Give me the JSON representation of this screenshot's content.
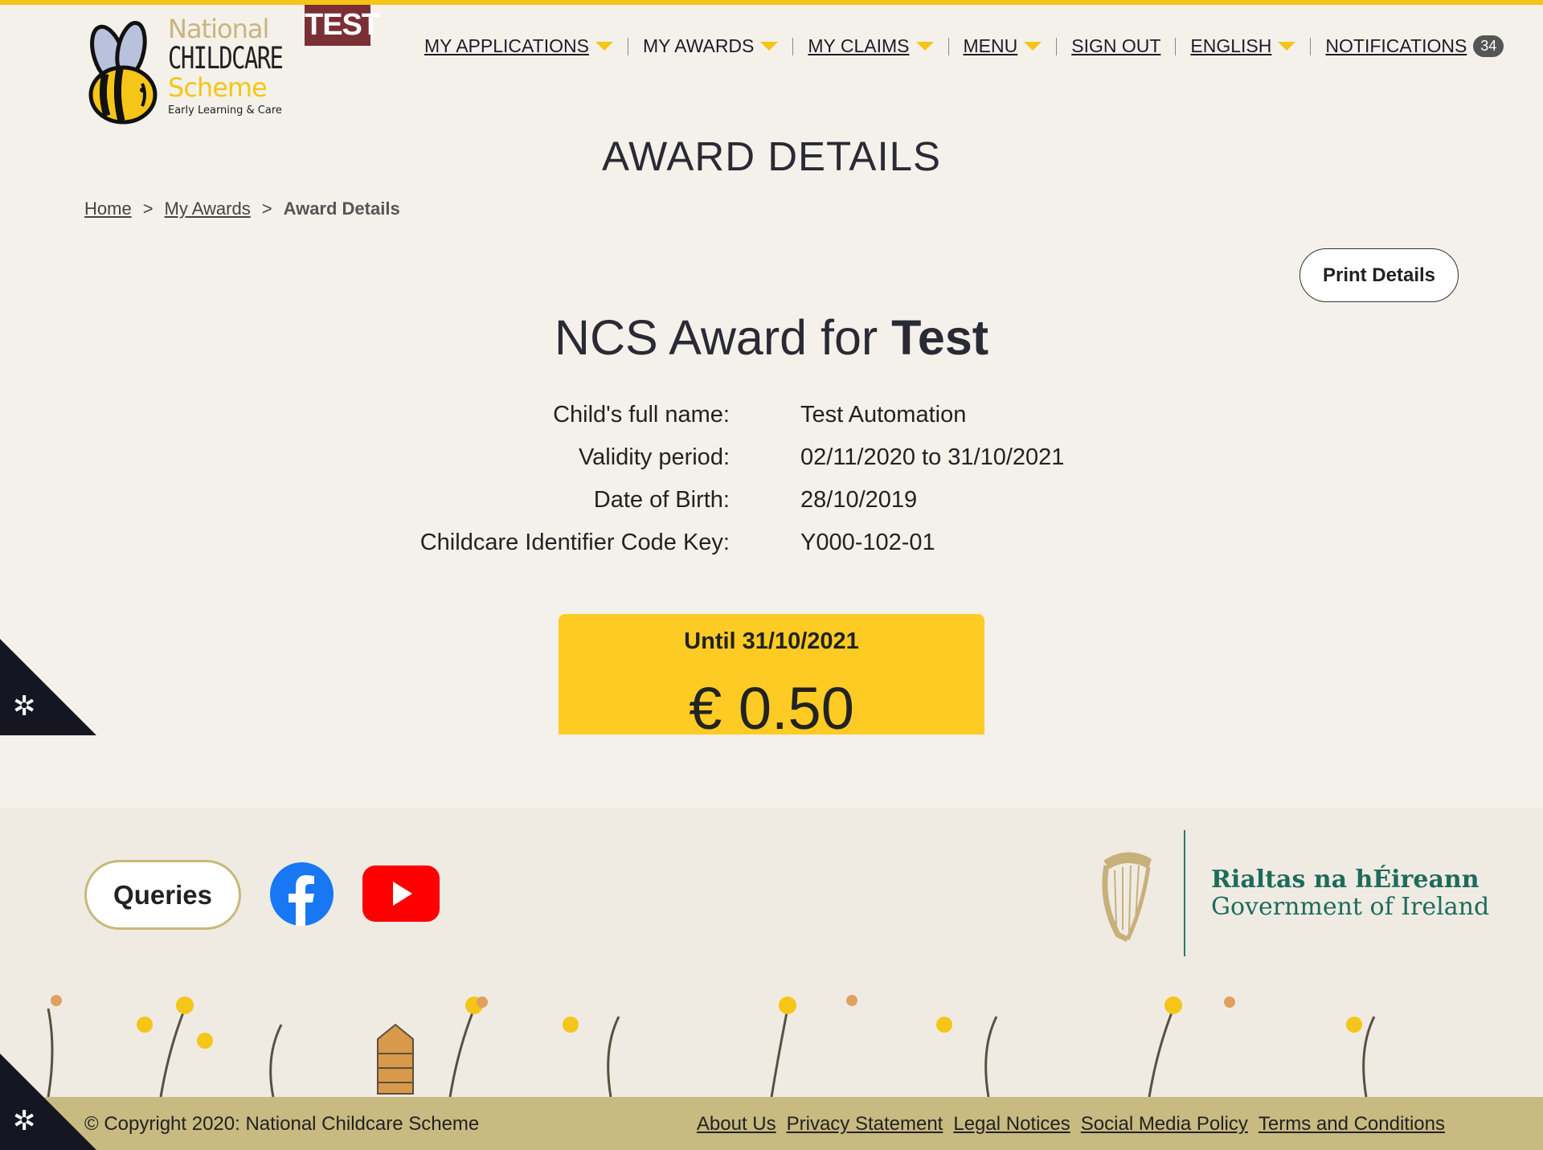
{
  "header": {
    "logo": {
      "line1": "National",
      "line2": "CHILDCARE",
      "line3": "Scheme",
      "line4": "Early Learning & Care"
    },
    "env_badge": "TEST",
    "nav": [
      {
        "label": "MY APPLICATIONS",
        "dropdown": true
      },
      {
        "label": "MY AWARDS",
        "dropdown": true
      },
      {
        "label": "MY CLAIMS",
        "dropdown": true
      },
      {
        "label": "MENU",
        "dropdown": true
      },
      {
        "label": "SIGN OUT",
        "dropdown": false
      },
      {
        "label": "ENGLISH",
        "dropdown": true
      },
      {
        "label": "NOTIFICATIONS",
        "dropdown": false
      }
    ],
    "notifications_count": "34"
  },
  "page_title": "AWARD DETAILS",
  "breadcrumb": {
    "home": "Home",
    "sep": ">",
    "my_awards": "My Awards",
    "current": "Award Details"
  },
  "print_button": "Print Details",
  "award": {
    "title_prefix": "NCS Award for",
    "title_name": "Test",
    "details": [
      {
        "label": "Child's full name:",
        "value": "Test Automation"
      },
      {
        "label": "Validity period:",
        "value": "02/11/2020 to 31/10/2021"
      },
      {
        "label": "Date of Birth:",
        "value": "28/10/2019"
      },
      {
        "label": "Childcare Identifier Code Key:",
        "value": "Y000-102-01"
      }
    ],
    "until": "Until 31/10/2021",
    "amount": "€ 0.50"
  },
  "footer": {
    "queries": "Queries",
    "gov_line1": "Rialtas na hÉireann",
    "gov_line2": "Government of Ireland",
    "copyright": "© Copyright 2020: National Childcare Scheme",
    "links": [
      "About Us",
      "Privacy Statement",
      "Legal Notices",
      "Social Media Policy",
      "Terms and Conditions"
    ]
  },
  "colors": {
    "accent": "#f5c518",
    "award_box": "#fdcb24",
    "gov_green": "#1e6b5c",
    "footer_bar": "#c8ba81"
  },
  "icons": {
    "cookie": "gear-icon",
    "facebook": "facebook-icon",
    "youtube": "youtube-icon",
    "harp": "harp-icon",
    "logo": "bee-icon"
  }
}
